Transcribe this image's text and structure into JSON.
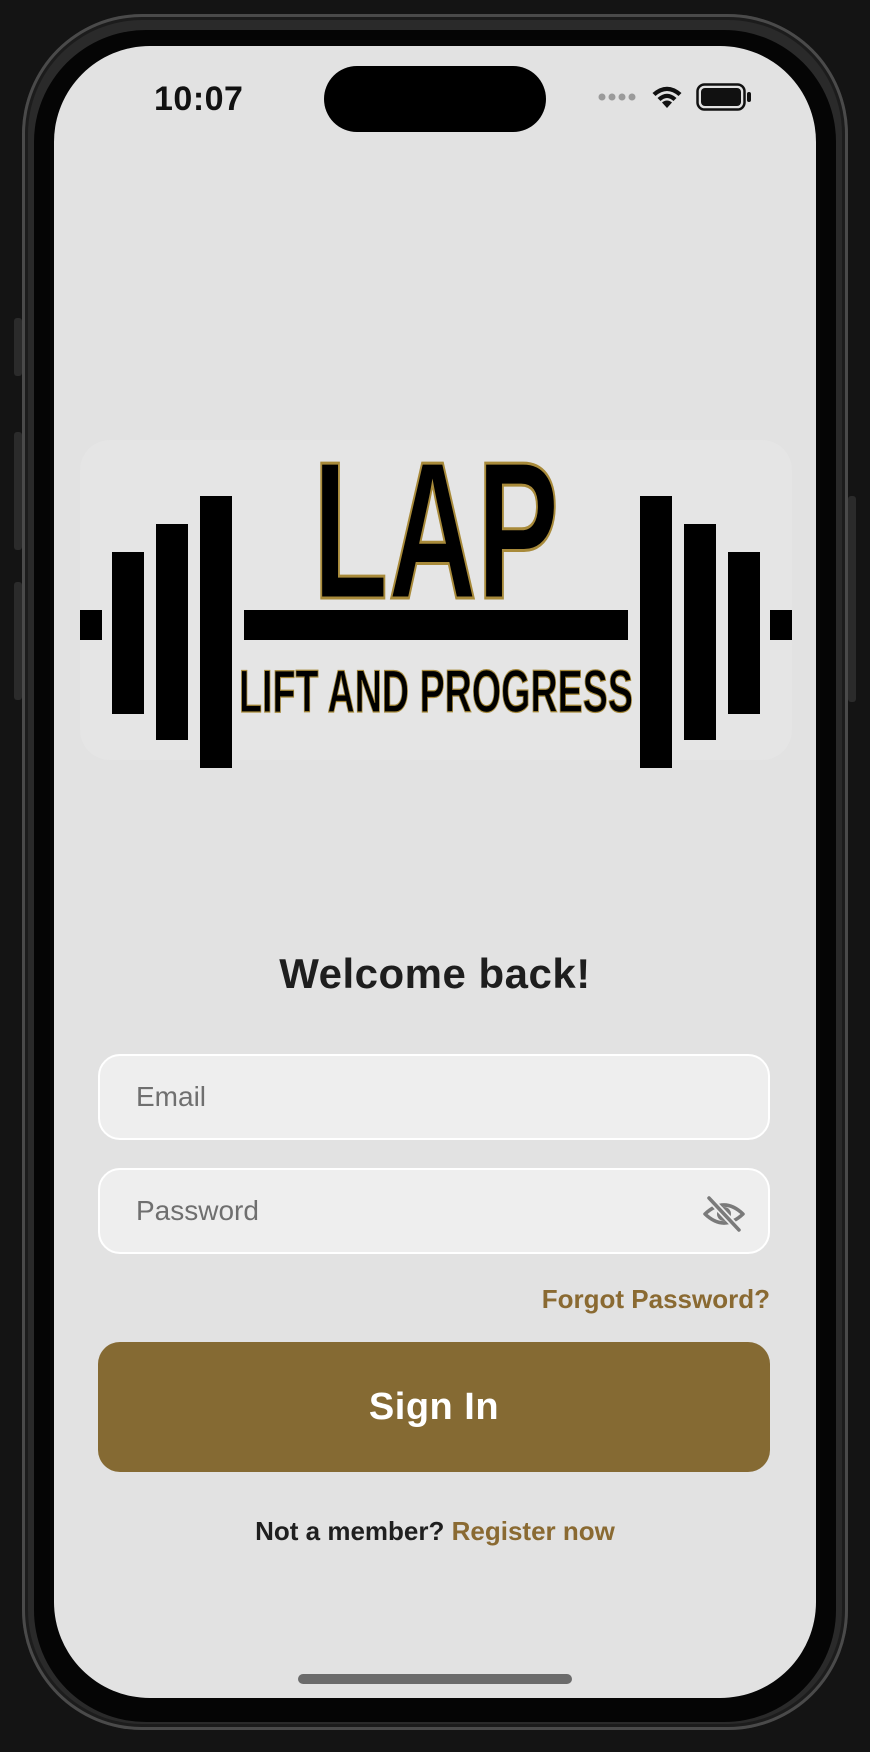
{
  "status_bar": {
    "time": "10:07",
    "icons": [
      "signal-dots-icon",
      "wifi-icon",
      "battery-icon"
    ]
  },
  "logo": {
    "brand_mark": "LAP",
    "tagline": "LIFT AND PROGRESS"
  },
  "login": {
    "heading": "Welcome back!",
    "email_placeholder": "Email",
    "email_value": "",
    "password_placeholder": "Password",
    "password_value": "",
    "password_toggle_icon": "eye-off-icon",
    "forgot_label": "Forgot Password?",
    "signin_label": "Sign In",
    "register_prompt": "Not a member?",
    "register_link": "Register now"
  },
  "colors": {
    "accent": "#856a33",
    "link": "#8a6a32",
    "background": "#e2e2e2",
    "field_bg": "#eeeeee"
  }
}
